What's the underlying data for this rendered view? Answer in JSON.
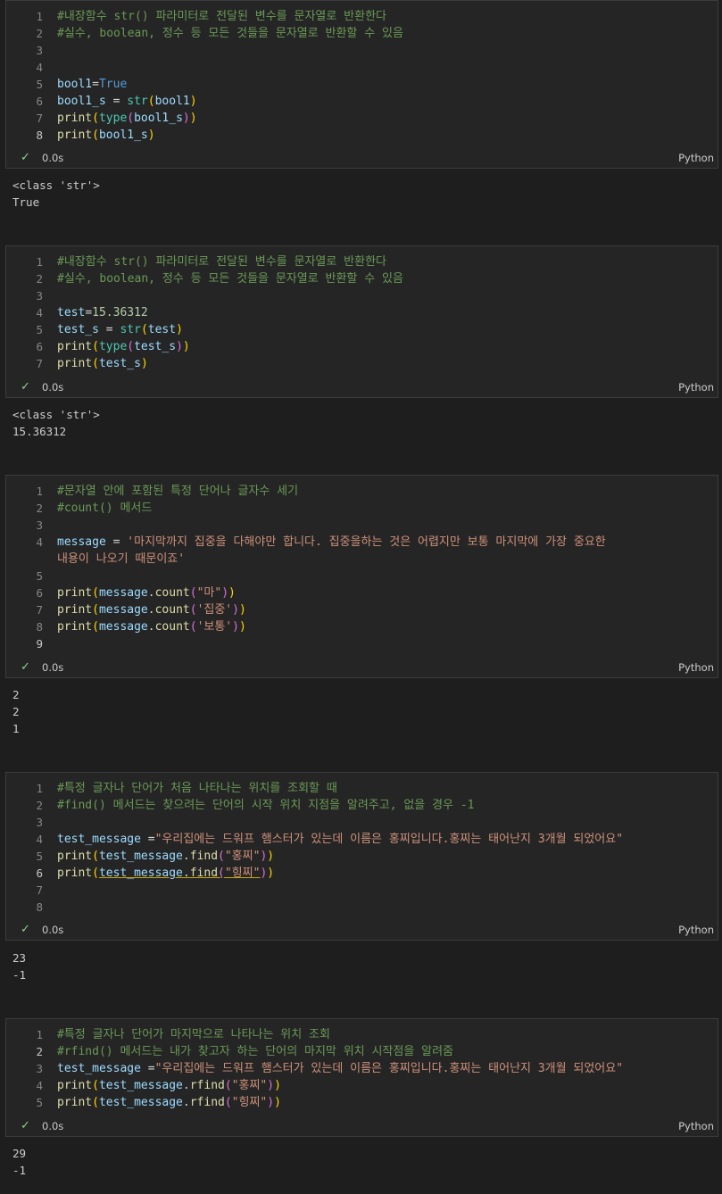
{
  "cells": [
    {
      "lines": [
        {
          "n": "1",
          "tokens": [
            {
              "t": "cm",
              "v": "#내장함수 str() 파라미터로 전달된 변수를 문자열로 반환한다"
            }
          ]
        },
        {
          "n": "2",
          "tokens": [
            {
              "t": "cm",
              "v": "#실수, boolean, 정수 등 모든 것들을 문자열로 반환할 수 있음"
            }
          ]
        },
        {
          "n": "3",
          "tokens": []
        },
        {
          "n": "4",
          "tokens": []
        },
        {
          "n": "5",
          "tokens": [
            {
              "t": "vr",
              "v": "bool1"
            },
            {
              "t": "op",
              "v": "="
            },
            {
              "t": "kw",
              "v": "True"
            }
          ]
        },
        {
          "n": "6",
          "tokens": [
            {
              "t": "vr",
              "v": "bool1_s"
            },
            {
              "t": "op",
              "v": " = "
            },
            {
              "t": "bi",
              "v": "str"
            },
            {
              "t": "p1",
              "v": "("
            },
            {
              "t": "vr",
              "v": "bool1"
            },
            {
              "t": "p1",
              "v": ")"
            }
          ]
        },
        {
          "n": "7",
          "tokens": [
            {
              "t": "fn",
              "v": "print"
            },
            {
              "t": "p1",
              "v": "("
            },
            {
              "t": "bi",
              "v": "type"
            },
            {
              "t": "p2",
              "v": "("
            },
            {
              "t": "vr",
              "v": "bool1_s"
            },
            {
              "t": "p2",
              "v": ")"
            },
            {
              "t": "p1",
              "v": ")"
            }
          ]
        },
        {
          "n": "8",
          "cur": true,
          "tokens": [
            {
              "t": "fn",
              "v": "print"
            },
            {
              "t": "p1",
              "v": "("
            },
            {
              "t": "vr",
              "v": "bool1_s"
            },
            {
              "t": "p1",
              "v": ")"
            }
          ]
        }
      ],
      "time": "0.0s",
      "lang": "Python",
      "output": "<class 'str'>\nTrue"
    },
    {
      "lines": [
        {
          "n": "1",
          "tokens": [
            {
              "t": "cm",
              "v": "#내장함수 str() 파라미터로 전달된 변수를 문자열로 반환한다"
            }
          ]
        },
        {
          "n": "2",
          "tokens": [
            {
              "t": "cm",
              "v": "#실수, boolean, 정수 등 모든 것들을 문자열로 반환할 수 있음"
            }
          ]
        },
        {
          "n": "3",
          "tokens": []
        },
        {
          "n": "4",
          "tokens": [
            {
              "t": "vr",
              "v": "test"
            },
            {
              "t": "op",
              "v": "="
            },
            {
              "t": "nm",
              "v": "15.36312"
            }
          ]
        },
        {
          "n": "5",
          "tokens": [
            {
              "t": "vr",
              "v": "test_s"
            },
            {
              "t": "op",
              "v": " = "
            },
            {
              "t": "bi",
              "v": "str"
            },
            {
              "t": "p1",
              "v": "("
            },
            {
              "t": "vr",
              "v": "test"
            },
            {
              "t": "p1",
              "v": ")"
            }
          ]
        },
        {
          "n": "6",
          "tokens": [
            {
              "t": "fn",
              "v": "print"
            },
            {
              "t": "p1",
              "v": "("
            },
            {
              "t": "bi",
              "v": "type"
            },
            {
              "t": "p2",
              "v": "("
            },
            {
              "t": "vr",
              "v": "test_s"
            },
            {
              "t": "p2",
              "v": ")"
            },
            {
              "t": "p1",
              "v": ")"
            }
          ]
        },
        {
          "n": "7",
          "tokens": [
            {
              "t": "fn",
              "v": "print"
            },
            {
              "t": "p1",
              "v": "("
            },
            {
              "t": "vr",
              "v": "test_s"
            },
            {
              "t": "p1",
              "v": ")"
            }
          ]
        }
      ],
      "time": "0.0s",
      "lang": "Python",
      "output": "<class 'str'>\n15.36312"
    },
    {
      "lines": [
        {
          "n": "1",
          "tokens": [
            {
              "t": "cm",
              "v": "#문자열 안에 포함된 특정 단어나 글자수 세기"
            }
          ]
        },
        {
          "n": "2",
          "tokens": [
            {
              "t": "cm",
              "v": "#count() 메서드"
            }
          ]
        },
        {
          "n": "3",
          "tokens": []
        },
        {
          "n": "4",
          "tokens": [
            {
              "t": "vr",
              "v": "message"
            },
            {
              "t": "op",
              "v": " = "
            },
            {
              "t": "st",
              "v": "'마지막까지 집중을 다해야만 합니다. 집중을하는 것은 어렵지만 보통 마지막에 가장 중요한"
            }
          ]
        },
        {
          "n": "",
          "tokens": [
            {
              "t": "st",
              "v": "내용이 나오기 때문이죠'"
            }
          ]
        },
        {
          "n": "5",
          "tokens": []
        },
        {
          "n": "6",
          "tokens": [
            {
              "t": "fn",
              "v": "print"
            },
            {
              "t": "p1",
              "v": "("
            },
            {
              "t": "vr",
              "v": "message"
            },
            {
              "t": "op",
              "v": "."
            },
            {
              "t": "fn",
              "v": "count"
            },
            {
              "t": "p2",
              "v": "("
            },
            {
              "t": "st",
              "v": "\"마\""
            },
            {
              "t": "p2",
              "v": ")"
            },
            {
              "t": "p1",
              "v": ")"
            }
          ]
        },
        {
          "n": "7",
          "tokens": [
            {
              "t": "fn",
              "v": "print"
            },
            {
              "t": "p1",
              "v": "("
            },
            {
              "t": "vr",
              "v": "message"
            },
            {
              "t": "op",
              "v": "."
            },
            {
              "t": "fn",
              "v": "count"
            },
            {
              "t": "p2",
              "v": "("
            },
            {
              "t": "st",
              "v": "'집중'"
            },
            {
              "t": "p2",
              "v": ")"
            },
            {
              "t": "p1",
              "v": ")"
            }
          ]
        },
        {
          "n": "8",
          "tokens": [
            {
              "t": "fn",
              "v": "print"
            },
            {
              "t": "p1",
              "v": "("
            },
            {
              "t": "vr",
              "v": "message"
            },
            {
              "t": "op",
              "v": "."
            },
            {
              "t": "fn",
              "v": "count"
            },
            {
              "t": "p2",
              "v": "("
            },
            {
              "t": "st",
              "v": "'보통'"
            },
            {
              "t": "p2",
              "v": ")"
            },
            {
              "t": "p1",
              "v": ")"
            }
          ]
        },
        {
          "n": "9",
          "cur": true,
          "tokens": []
        }
      ],
      "time": "0.0s",
      "lang": "Python",
      "output": "2\n2\n1"
    },
    {
      "lines": [
        {
          "n": "1",
          "tokens": [
            {
              "t": "cm",
              "v": "#특정 글자나 단어가 처음 나타나는 위치를 조회할 때"
            }
          ]
        },
        {
          "n": "2",
          "tokens": [
            {
              "t": "cm",
              "v": "#find() 메서드는 찾으려는 단어의 시작 위치 지점을 알려주고, 없을 경우 -1"
            }
          ]
        },
        {
          "n": "3",
          "tokens": []
        },
        {
          "n": "4",
          "tokens": [
            {
              "t": "vr",
              "v": "test_message"
            },
            {
              "t": "op",
              "v": " ="
            },
            {
              "t": "st",
              "v": "\"우리집에는 드워프 햄스터가 있는데 이름은 홍찌입니다.홍찌는 태어난지 3개월 되었어요\""
            }
          ]
        },
        {
          "n": "5",
          "tokens": [
            {
              "t": "fn",
              "v": "print"
            },
            {
              "t": "p1",
              "v": "("
            },
            {
              "t": "vr",
              "v": "test_message"
            },
            {
              "t": "op",
              "v": "."
            },
            {
              "t": "fn",
              "v": "find"
            },
            {
              "t": "p2",
              "v": "("
            },
            {
              "t": "st",
              "v": "\"홍찌\""
            },
            {
              "t": "p2",
              "v": ")"
            },
            {
              "t": "p1",
              "v": ")"
            }
          ]
        },
        {
          "n": "6",
          "cur": true,
          "tokens": [
            {
              "t": "fn",
              "v": "print"
            },
            {
              "t": "p1",
              "v": "("
            },
            {
              "t": "vr ul",
              "v": "test_message"
            },
            {
              "t": "op ul",
              "v": "."
            },
            {
              "t": "fn ul",
              "v": "find"
            },
            {
              "t": "p2 ul",
              "v": "("
            },
            {
              "t": "st ul",
              "v": "\"힝찌\""
            },
            {
              "t": "p2",
              "v": ")"
            },
            {
              "t": "p1",
              "v": ")"
            }
          ]
        },
        {
          "n": "7",
          "tokens": []
        },
        {
          "n": "8",
          "tokens": []
        }
      ],
      "time": "0.0s",
      "lang": "Python",
      "output": "23\n-1"
    },
    {
      "lines": [
        {
          "n": "1",
          "tokens": [
            {
              "t": "cm",
              "v": "#특정 글자나 단어가 마지막으로 나타나는 위치 조회"
            }
          ]
        },
        {
          "n": "2",
          "cur": true,
          "tokens": [
            {
              "t": "cm",
              "v": "#rfind() 메서드는 내가 찾고자 하는 단어의 마지막 위치 시작점을 알려줌"
            }
          ]
        },
        {
          "n": "3",
          "tokens": [
            {
              "t": "vr",
              "v": "test_message"
            },
            {
              "t": "op",
              "v": " ="
            },
            {
              "t": "st",
              "v": "\"우리집에는 드워프 햄스터가 있는데 이름은 홍찌입니다.홍찌는 태어난지 3개월 되었어요\""
            }
          ]
        },
        {
          "n": "4",
          "tokens": [
            {
              "t": "fn",
              "v": "print"
            },
            {
              "t": "p1",
              "v": "("
            },
            {
              "t": "vr",
              "v": "test_message"
            },
            {
              "t": "op",
              "v": "."
            },
            {
              "t": "fn",
              "v": "rfind"
            },
            {
              "t": "p2",
              "v": "("
            },
            {
              "t": "st",
              "v": "\"홍찌\""
            },
            {
              "t": "p2",
              "v": ")"
            },
            {
              "t": "p1",
              "v": ")"
            }
          ]
        },
        {
          "n": "5",
          "tokens": [
            {
              "t": "fn",
              "v": "print"
            },
            {
              "t": "p1",
              "v": "("
            },
            {
              "t": "vr",
              "v": "test_message"
            },
            {
              "t": "op",
              "v": "."
            },
            {
              "t": "fn",
              "v": "rfind"
            },
            {
              "t": "p2",
              "v": "("
            },
            {
              "t": "st",
              "v": "\"힝찌\""
            },
            {
              "t": "p2",
              "v": ")"
            },
            {
              "t": "p1",
              "v": ")"
            }
          ]
        }
      ],
      "time": "0.0s",
      "lang": "Python",
      "output": "29\n-1"
    }
  ]
}
